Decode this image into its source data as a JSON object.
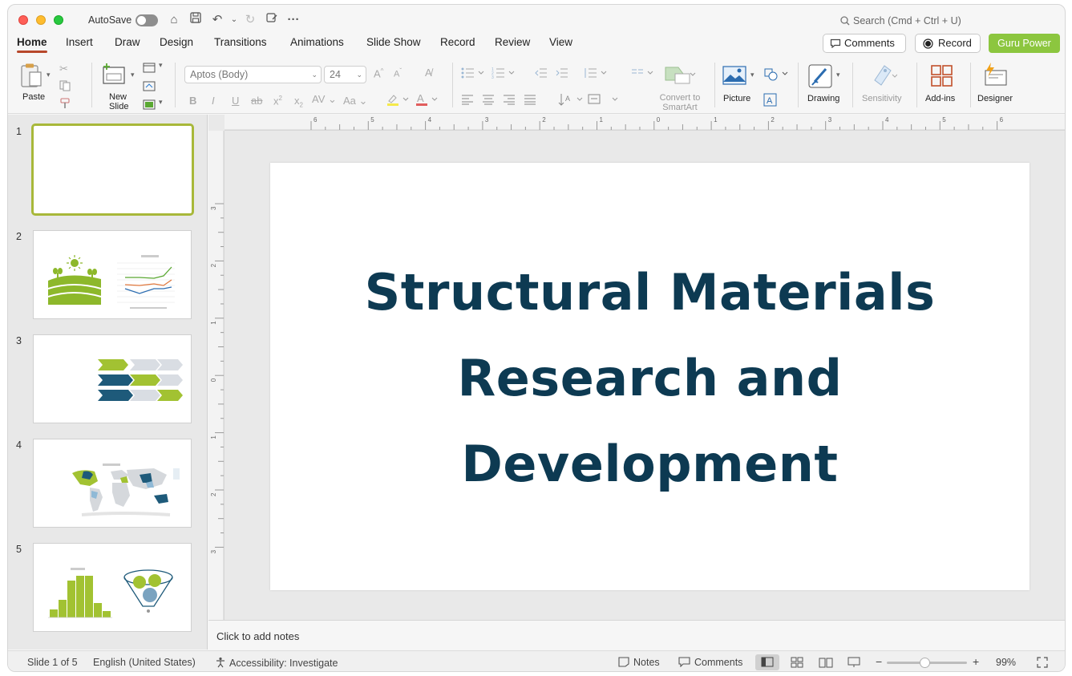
{
  "titlebar": {
    "autosave_label": "AutoSave",
    "search_placeholder": "Search (Cmd + Ctrl + U)"
  },
  "tabs": [
    "Home",
    "Insert",
    "Draw",
    "Design",
    "Transitions",
    "Animations",
    "Slide Show",
    "Record",
    "Review",
    "View"
  ],
  "active_tab": "Home",
  "actions": {
    "comments": "Comments",
    "record": "Record",
    "guru": "Guru Power",
    "guru_color": "#8cc63f"
  },
  "ribbon": {
    "paste": "Paste",
    "new_slide_line1": "New",
    "new_slide_line2": "Slide",
    "font_name": "Aptos (Body)",
    "font_size": "24",
    "convert_line1": "Convert to",
    "convert_line2": "SmartArt",
    "picture": "Picture",
    "drawing": "Drawing",
    "sensitivity": "Sensitivity",
    "addins": "Add-ins",
    "designer": "Designer"
  },
  "thumbnails": [
    "1",
    "2",
    "3",
    "4",
    "5"
  ],
  "slide": {
    "title_line1": "Structural Materials",
    "title_line2": "Research and",
    "title_line3": "Development",
    "title_color": "#0d3a52"
  },
  "notes_placeholder": "Click to add notes",
  "status": {
    "slide_info": "Slide 1 of 5",
    "language": "English (United States)",
    "accessibility": "Accessibility: Investigate",
    "notes": "Notes",
    "comments": "Comments",
    "zoom": "99%"
  },
  "ruler": {
    "h_ticks": [
      "6",
      "5",
      "4",
      "3",
      "2",
      "1",
      "0",
      "1",
      "2",
      "3",
      "4",
      "5",
      "6"
    ],
    "v_ticks": [
      "3",
      "2",
      "1",
      "0",
      "1",
      "2",
      "3"
    ]
  }
}
